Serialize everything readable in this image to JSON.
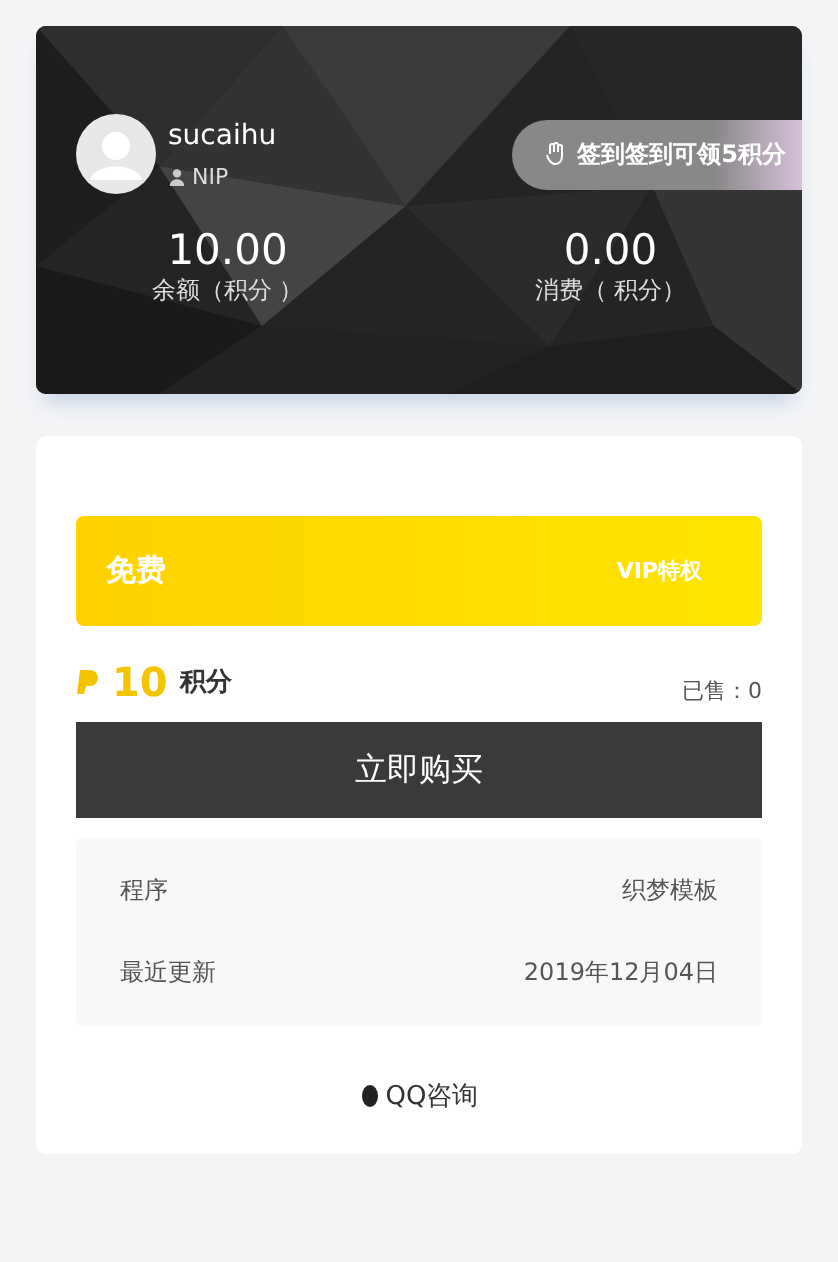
{
  "user": {
    "name": "sucaihu",
    "level": "NIP",
    "checkin": "签到签到可领5积分",
    "stats": [
      {
        "value": "10.00",
        "label": "余额（积分 ）"
      },
      {
        "value": "0.00",
        "label": "消费（ 积分）"
      }
    ]
  },
  "offer": {
    "title": "免费",
    "vip": "VIP特权"
  },
  "price": {
    "amount": "10",
    "unit": "积分",
    "sold": "已售：0"
  },
  "buy_button": "立即购买",
  "info": [
    {
      "label": "程序",
      "value": "织梦模板"
    },
    {
      "label": "最近更新",
      "value": "2019年12月04日"
    }
  ],
  "contact": "QQ咨询"
}
